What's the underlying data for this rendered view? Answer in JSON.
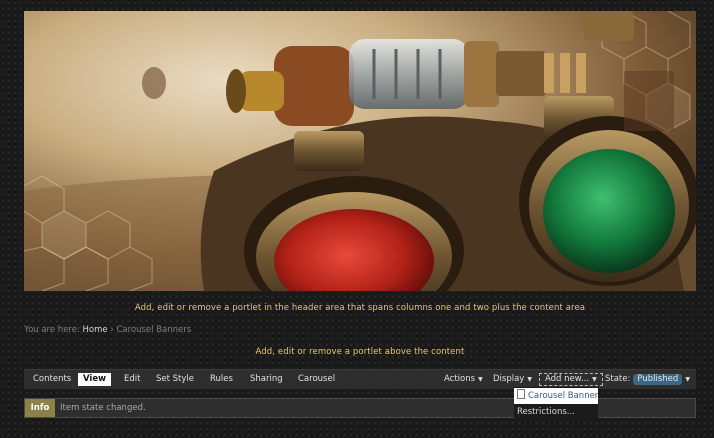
{
  "portlets": {
    "header_hint": "Add, edit or remove a portlet in the header area that spans columns one and two plus the content area",
    "above_content_hint": "Add, edit or remove a portlet above the content"
  },
  "breadcrumb": {
    "prefix": "You are here:",
    "home": "Home",
    "separator": "›",
    "current": "Carousel Banners"
  },
  "toolbar": {
    "tabs": [
      "Contents",
      "View",
      "Edit",
      "Set Style",
      "Rules",
      "Sharing",
      "Carousel"
    ],
    "active_tab": "View",
    "actions_label": "Actions",
    "display_label": "Display",
    "add_new_label": "Add new...",
    "state_label": "State:",
    "state_value": "Published"
  },
  "add_new_menu": {
    "items": [
      "Carousel Banner",
      "Restrictions..."
    ]
  },
  "status_message": {
    "label": "Info",
    "text": "Item state changed."
  },
  "colors": {
    "hint_text": "#e2c774",
    "state_badge": "#3d6680",
    "info_label": "#8a8248"
  }
}
